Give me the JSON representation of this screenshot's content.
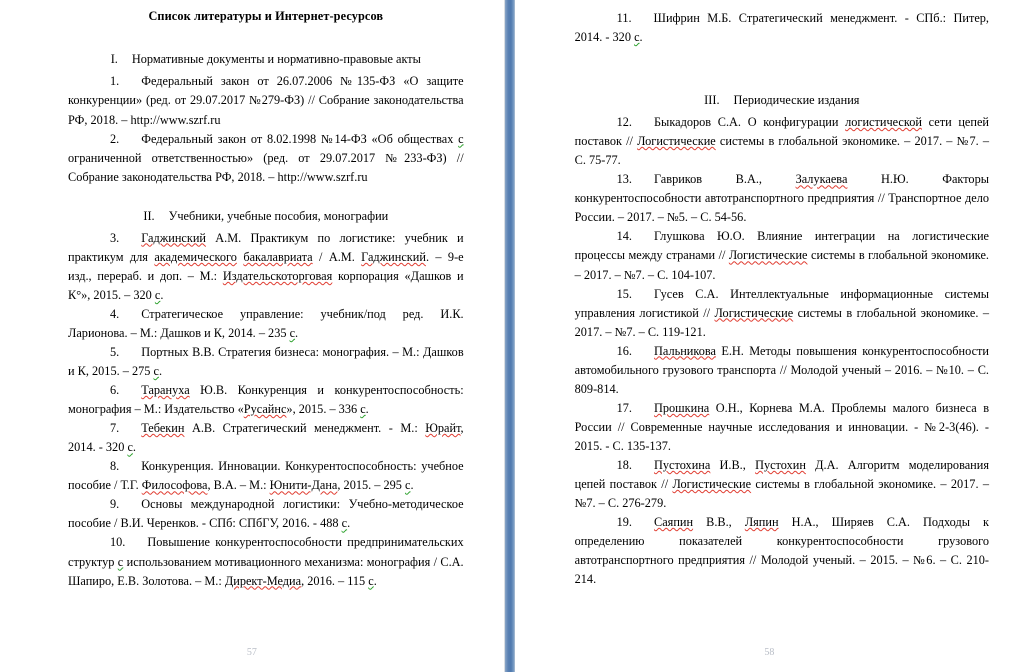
{
  "document": {
    "title": "Список литературы и Интернет-ресурсов",
    "divider_color": "#5b82b4",
    "spelling_underline_color": "#e03c31",
    "grammar_underline_color": "#2aa02a"
  },
  "pages": [
    {
      "page_number": "57",
      "sections": [
        {
          "roman": "I.",
          "heading": "Нормативные документы и нормативно-правовые акты",
          "entries": [
            {
              "num": "1.",
              "text": "Федеральный закон от 26.07.2006 №135-ФЗ «О защите конкуренции» (ред. от 29.07.2017 №279-ФЗ) // Собрание законодательства РФ, 2018. – http://www.szrf.ru"
            },
            {
              "num": "2.",
              "text": "Федеральный закон от 8.02.1998 №14-ФЗ «Об обществах с ограниченной ответственностью» (ред. от 29.07.2017 №233-ФЗ) // Собрание законодательства РФ, 2018. – http://www.szrf.ru"
            }
          ]
        },
        {
          "roman": "II.",
          "heading": "Учебники, учебные пособия, монографии",
          "entries": [
            {
              "num": "3.",
              "text": "Гаджинский А.М. Практикум по логистике: учебник и практикум для академического бакалавриата / А.М. Гаджинский. – 9-е изд., перераб. и доп. – М.: Издательскоторговая корпорация «Дашков и К°», 2015. – 320 с."
            },
            {
              "num": "4.",
              "text": "Стратегическое управление: учебник/под ред. И.К. Ларионова. – М.: Дашков и К, 2014. – 235 с."
            },
            {
              "num": "5.",
              "text": "Портных В.В. Стратегия бизнеса: монография. – М.: Дашков и К, 2015. – 275 с."
            },
            {
              "num": "6.",
              "text": "Тарануха Ю.В. Конкуренция и конкурентоспособность: монография – М.: Издательство «Русайнс», 2015. – 336 с."
            },
            {
              "num": "7.",
              "text": "Тебекин А.В. Стратегический менеджмент. - М.: Юрайт, 2014. - 320 с."
            },
            {
              "num": "8.",
              "text": "Конкуренция. Инновации. Конкурентоспособность: учебное пособие / Т.Г. Философова, В.А. – М.: Юнити-Дана, 2015. – 295 с."
            },
            {
              "num": "9.",
              "text": "Основы международной логистики: Учебно-методическое пособие / В.И. Черенков. - СПб: СПбГУ, 2016. - 488 с."
            },
            {
              "num": "10.",
              "text": "Повышение конкурентоспособности предпринимательских структур с использованием мотивационного механизма: монография / С.А. Шапиро, Е.В. Золотова. – М.: Директ-Медиа, 2016. – 115 с."
            }
          ]
        }
      ]
    },
    {
      "page_number": "58",
      "sections": [
        {
          "roman": "",
          "heading": "",
          "entries": [
            {
              "num": "11.",
              "text": "Шифрин М.Б. Стратегический менеджмент. - СПб.: Питер, 2014. - 320 с."
            }
          ]
        },
        {
          "roman": "III.",
          "heading": "Периодические издания",
          "entries": [
            {
              "num": "12.",
              "text": "Быкадоров С.А. О конфигурации логистической сети цепей поставок // Логистические системы в глобальной экономике. – 2017. – №7. – С. 75-77."
            },
            {
              "num": "13.",
              "text": "Гавриков В.А., Залукаева Н.Ю. Факторы конкурентоспособности автотранспортного предприятия // Транспортное дело России. – 2017. – №5. – С. 54-56."
            },
            {
              "num": "14.",
              "text": "Глушкова Ю.О. Влияние интеграции на логистические процессы между странами // Логистические системы в глобальной экономике. – 2017. – №7. – С. 104-107."
            },
            {
              "num": "15.",
              "text": "Гусев С.А. Интеллектуальные информационные системы управления логистикой // Логистические системы в глобальной экономике. – 2017. – №7. – С. 119-121."
            },
            {
              "num": "16.",
              "text": "Пальникова Е.Н. Методы повышения конкурентоспособности автомобильного грузового транспорта // Молодой ученый – 2016. – №10. – С. 809-814."
            },
            {
              "num": "17.",
              "text": "Прошкина О.Н., Корнева М.А. Проблемы малого бизнеса в России // Современные научные исследования и инновации. - №2-3(46). - 2015. - С. 135-137."
            },
            {
              "num": "18.",
              "text": "Пустохина И.В., Пустохин Д.А. Алгоритм моделирования цепей поставок // Логистические системы в глобальной экономике. – 2017. – №7. – С. 276-279."
            },
            {
              "num": "19.",
              "text": "Саяпин В.В., Ляпин Н.А., Ширяев С.А. Подходы к определению показателей конкурентоспособности грузового автотранспортного предприятия // Молодой ученый. – 2015. – №6. – С. 210-214."
            }
          ]
        }
      ]
    }
  ],
  "misspelled_words": [
    "Гаджинский",
    "академического",
    "бакалавриата",
    "Издательскоторговая",
    "Тарануха",
    "Русайнс",
    "Тебекин",
    "Юрайт",
    "Философова",
    "Юнити-Дана",
    "Директ-Медиа",
    "логистической",
    "Логистические",
    "Залукаева",
    "Пальникова",
    "Прошкина",
    "Пустохина",
    "Пустохин",
    "Саяпин",
    "Ляпин"
  ],
  "grammar_flagged_words": [
    "с"
  ]
}
